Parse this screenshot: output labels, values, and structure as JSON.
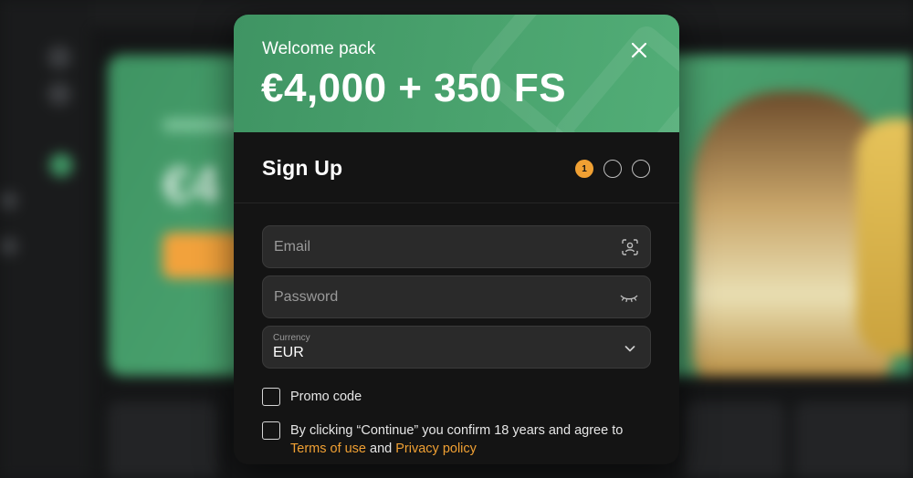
{
  "modal": {
    "header": {
      "subtitle": "Welcome pack",
      "title": "€4,000 + 350 FS",
      "close_icon": "close-icon"
    },
    "form": {
      "title": "Sign Up",
      "steps": [
        {
          "label": "1",
          "state": "active"
        },
        {
          "label": "",
          "state": "inactive"
        },
        {
          "label": "",
          "state": "inactive"
        }
      ],
      "email": {
        "placeholder": "Email",
        "icon": "face-scan-icon"
      },
      "password": {
        "placeholder": "Password",
        "icon": "eye-closed-icon"
      },
      "currency": {
        "label": "Currency",
        "value": "EUR",
        "icon": "chevron-down-icon"
      },
      "promo": {
        "label": "Promo code",
        "checked": false
      },
      "terms": {
        "checked": false,
        "text_before": "By clicking “Continue” you confirm 18 years and agree to",
        "terms_link": "Terms of use",
        "and_text": "and",
        "privacy_link": "Privacy policy"
      }
    }
  },
  "colors": {
    "header_green": "#4ba46f",
    "accent_orange": "#f0a033",
    "modal_bg": "#141414",
    "field_bg": "#2a2a2a"
  }
}
